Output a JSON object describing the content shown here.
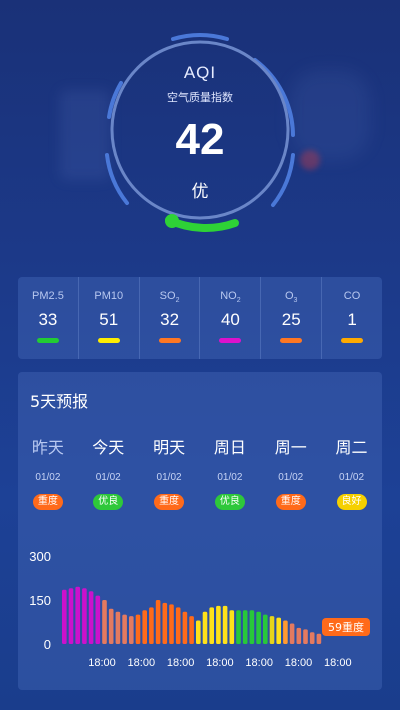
{
  "aqi": {
    "title": "AQI",
    "subtitle": "空气质量指数",
    "value": "42",
    "level": "优"
  },
  "pollutants": [
    {
      "name": "PM2.5",
      "sub": "",
      "value": "33",
      "color": "#22cc33"
    },
    {
      "name": "PM10",
      "sub": "",
      "value": "51",
      "color": "#ffee00"
    },
    {
      "name": "SO",
      "sub": "2",
      "value": "32",
      "color": "#ff7722"
    },
    {
      "name": "NO",
      "sub": "2",
      "value": "40",
      "color": "#dd11cc"
    },
    {
      "name": "O",
      "sub": "3",
      "value": "25",
      "color": "#ff7722"
    },
    {
      "name": "CO",
      "sub": "",
      "value": "1",
      "color": "#ffaa00"
    }
  ],
  "forecast": {
    "title": "5天预报",
    "days": [
      {
        "name": "昨天",
        "date": "01/02",
        "badge": "重度",
        "badge_color": "#ff6a1a",
        "past": true
      },
      {
        "name": "今天",
        "date": "01/02",
        "badge": "优良",
        "badge_color": "#2ec83a",
        "past": false
      },
      {
        "name": "明天",
        "date": "01/02",
        "badge": "重度",
        "badge_color": "#ff6a1a",
        "past": false
      },
      {
        "name": "周日",
        "date": "01/02",
        "badge": "优良",
        "badge_color": "#2ec83a",
        "past": false
      },
      {
        "name": "周一",
        "date": "01/02",
        "badge": "重度",
        "badge_color": "#ff6a1a",
        "past": false
      },
      {
        "name": "周二",
        "date": "01/02",
        "badge": "良好",
        "badge_color": "#f5d000",
        "past": false
      }
    ]
  },
  "chart_data": {
    "type": "bar",
    "yticks": [
      "300",
      "150",
      "0"
    ],
    "ylim": [
      0,
      300
    ],
    "xticks": [
      "18:00",
      "18:00",
      "18:00",
      "18:00",
      "18:00",
      "18:00",
      "18:00"
    ],
    "values": [
      185,
      190,
      195,
      190,
      180,
      165,
      150,
      120,
      110,
      100,
      95,
      100,
      115,
      125,
      150,
      140,
      135,
      125,
      110,
      95,
      80,
      110,
      125,
      130,
      130,
      115,
      115,
      115,
      115,
      110,
      100,
      95,
      90,
      80,
      70,
      55,
      50,
      40,
      35
    ],
    "colors": [
      "#cc11cc",
      "#cc11cc",
      "#cc11cc",
      "#cc11cc",
      "#cc11cc",
      "#cc11cc",
      "#e47a60",
      "#e47a60",
      "#e47a60",
      "#e47a60",
      "#e47a60",
      "#ff6a1a",
      "#ff6a1a",
      "#ff6a1a",
      "#ff6a1a",
      "#ff6a1a",
      "#ff6a1a",
      "#ff6a1a",
      "#ff6a1a",
      "#ff6a1a",
      "#ffe21a",
      "#ffe21a",
      "#ffe21a",
      "#ffe21a",
      "#ffe21a",
      "#ffe21a",
      "#28c83a",
      "#28c83a",
      "#28c83a",
      "#28c83a",
      "#28c83a",
      "#e7d51a",
      "#ffe21a",
      "#ff9a30",
      "#e47a60",
      "#e47a60",
      "#e47a60",
      "#e47a60",
      "#e47a60"
    ],
    "current_label": "59重度",
    "current_label_color": "#ff6a1a"
  }
}
